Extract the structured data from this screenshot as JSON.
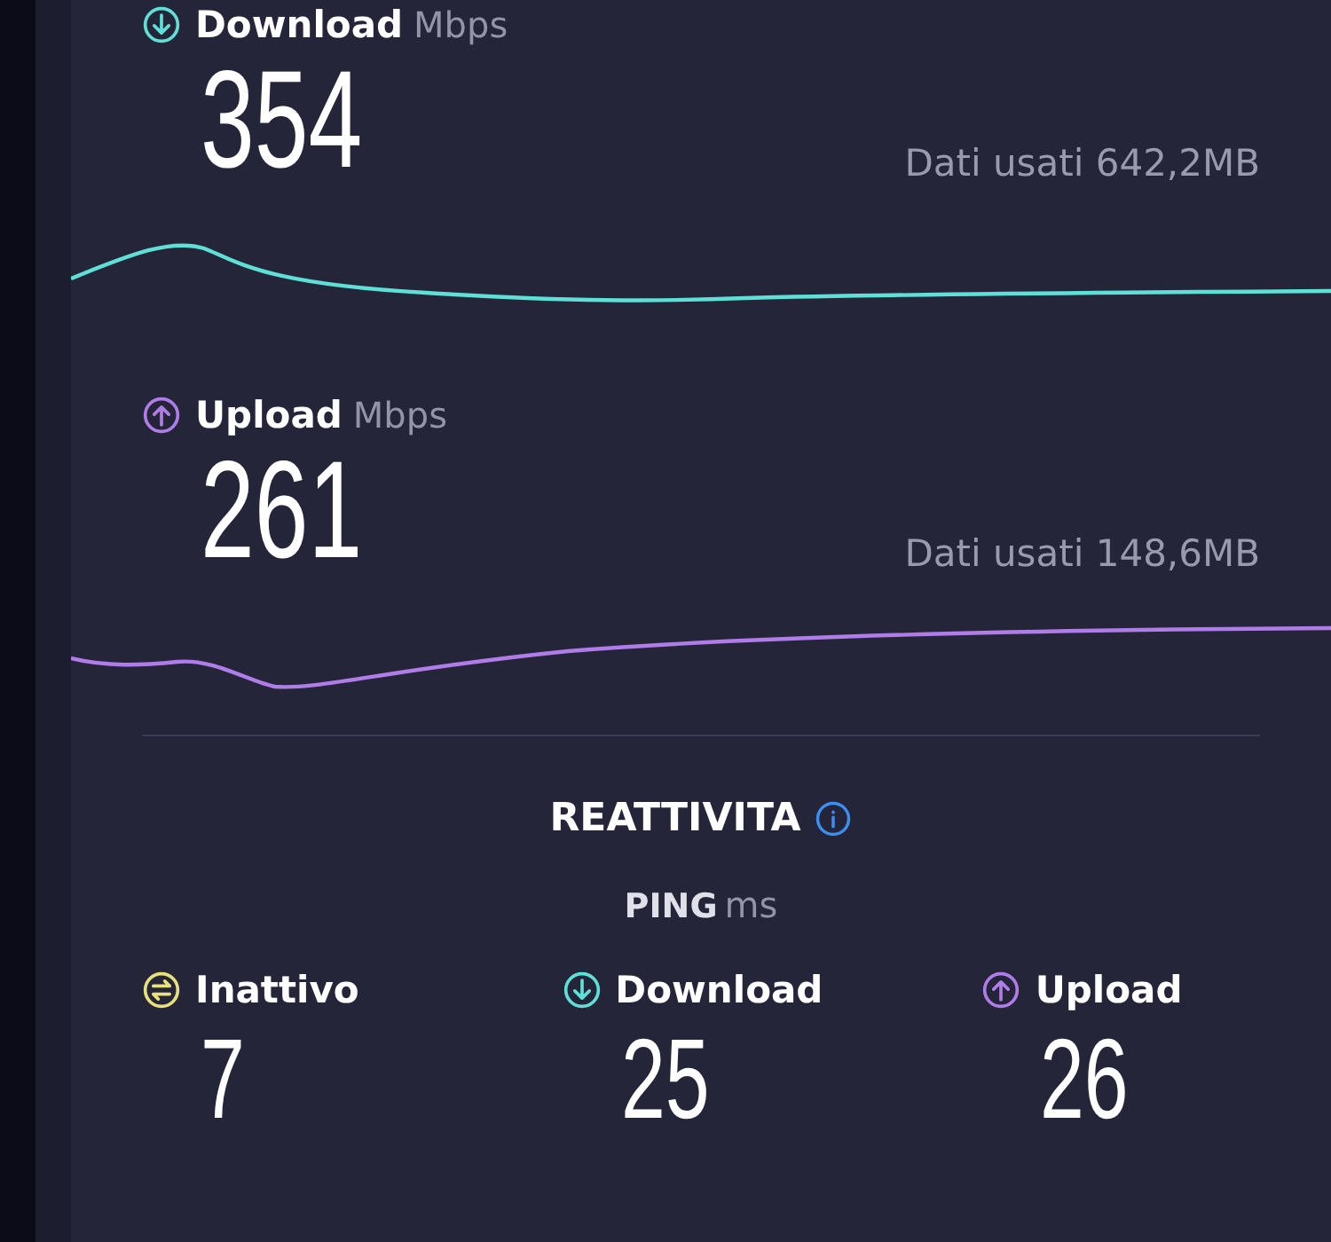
{
  "speeds": [
    {
      "kind": "download",
      "label": "Download",
      "unit": "Mbps",
      "value": "354",
      "data_used": "Dati usati 642,2MB",
      "color": "#5fe0d6"
    },
    {
      "kind": "upload",
      "label": "Upload",
      "unit": "Mbps",
      "value": "261",
      "data_used": "Dati usati 148,6MB",
      "color": "#b07ce8"
    }
  ],
  "responsiveness": {
    "title": "REATTIVITA",
    "ping_label": "PING",
    "ping_unit": "ms",
    "items": [
      {
        "kind": "idle",
        "label": "Inattivo",
        "value": "7",
        "color": "#e8e07a"
      },
      {
        "kind": "download",
        "label": "Download",
        "value": "25",
        "color": "#5fe0d6"
      },
      {
        "kind": "upload",
        "label": "Upload",
        "value": "26",
        "color": "#b07ce8"
      }
    ]
  }
}
